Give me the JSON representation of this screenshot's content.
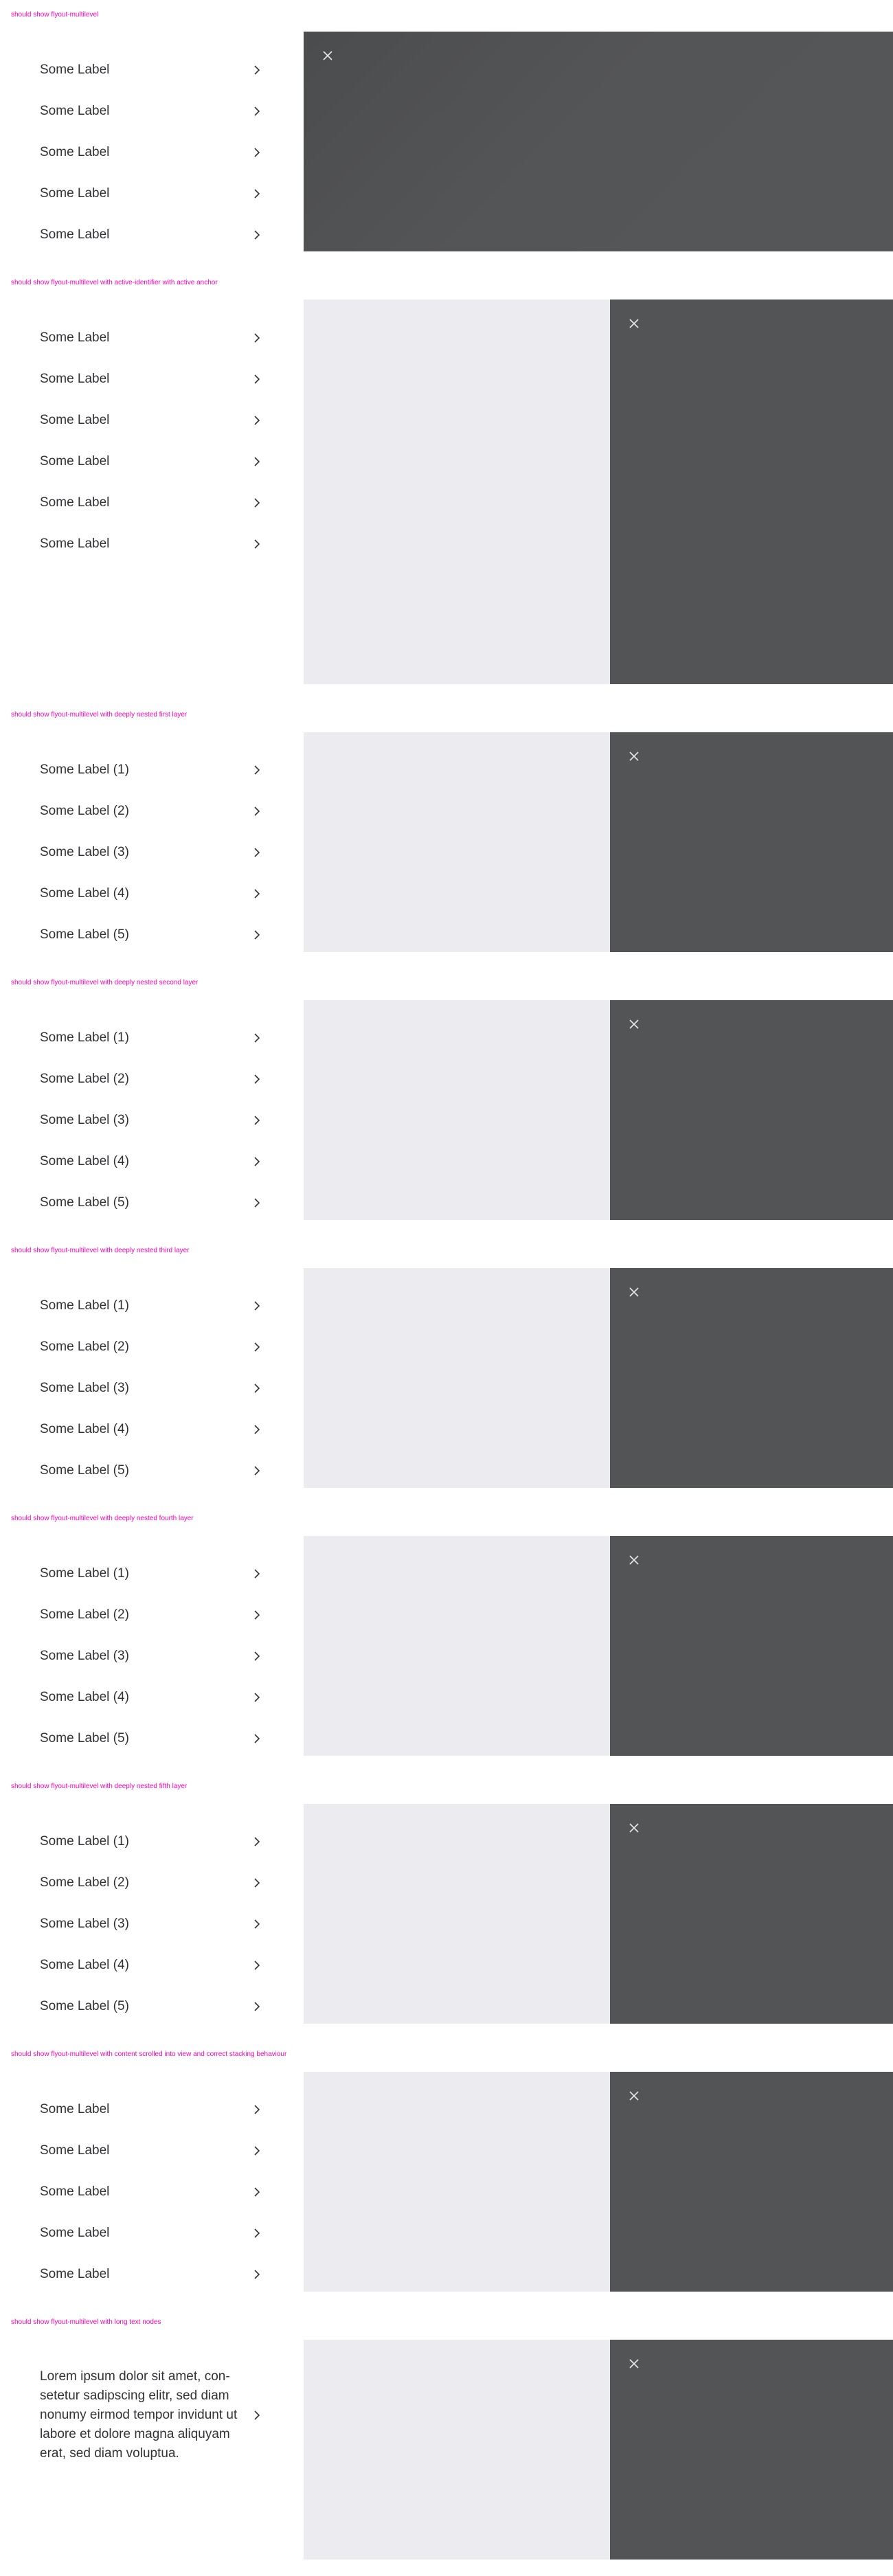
{
  "sections": [
    {
      "caption": "should show flyout-multilevel",
      "items": [
        "Some Label",
        "Some Label",
        "Some Label",
        "Some Label",
        "Some Label"
      ]
    },
    {
      "caption": "should show flyout-multilevel with active-identifier with active anchor",
      "items": [
        "Some Label",
        "Some Label",
        "Some Label",
        "Some Label",
        "Some Label",
        "Some Label"
      ]
    },
    {
      "caption": "should show flyout-multilevel with deeply nested first layer",
      "items": [
        "Some Label (1)",
        "Some Label (2)",
        "Some Label (3)",
        "Some Label (4)",
        "Some Label (5)"
      ]
    },
    {
      "caption": "should show flyout-multilevel with deeply nested second layer",
      "items": [
        "Some Label (1)",
        "Some Label (2)",
        "Some Label (3)",
        "Some Label (4)",
        "Some Label (5)"
      ]
    },
    {
      "caption": "should show flyout-multilevel with deeply nested third layer",
      "items": [
        "Some Label (1)",
        "Some Label (2)",
        "Some Label (3)",
        "Some Label (4)",
        "Some Label (5)"
      ]
    },
    {
      "caption": "should show flyout-multilevel with deeply nested fourth layer",
      "items": [
        "Some Label (1)",
        "Some Label (2)",
        "Some Label (3)",
        "Some Label (4)",
        "Some Label (5)"
      ]
    },
    {
      "caption": "should show flyout-multilevel with deeply nested fifth layer",
      "items": [
        "Some Label (1)",
        "Some Label (2)",
        "Some Label (3)",
        "Some Label (4)",
        "Some Label (5)"
      ]
    },
    {
      "caption": "should show flyout-multilevel with content scrolled into view and correct stacking behaviour",
      "items": [
        "Some Label",
        "Some Label",
        "Some Label",
        "Some Label",
        "Some Label"
      ]
    },
    {
      "caption": "should show flyout-multilevel with long text nodes",
      "items": [
        "Lorem ipsum dolor sit amet, con-setetur sadipscing elitr, sed diam nonumy eirmod tempor invidunt ut labore et dolore magna aliquyam erat, sed diam voluptua."
      ]
    }
  ],
  "icons": {
    "close": "close-icon",
    "chevron": "chevron-right-icon"
  },
  "colors": {
    "caption": "#ff00b4",
    "panel_bg": "#ececf0",
    "dark_bg": "#535456",
    "text": "#313236"
  }
}
